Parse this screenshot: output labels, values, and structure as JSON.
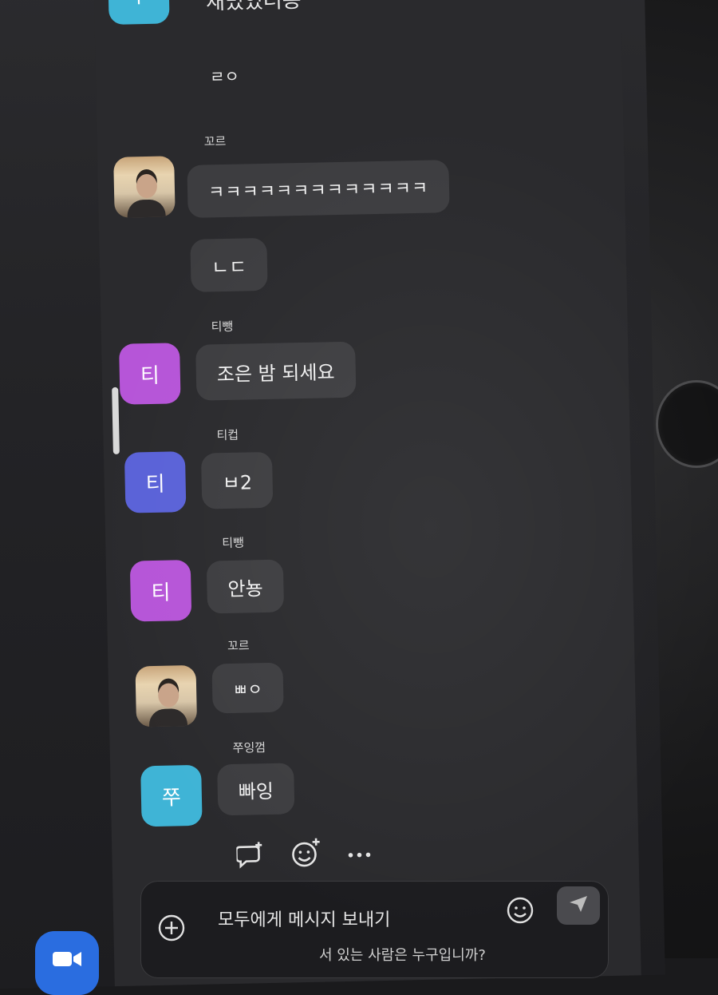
{
  "messages": [
    {
      "kind": "text-only",
      "text": "재밌었더용"
    },
    {
      "kind": "text-only",
      "text": "ㄹㅇ"
    },
    {
      "sender": "꼬르",
      "avatar": "photo",
      "bubbles": [
        "ㅋㅋㅋㅋㅋㅋㅋㅋㅋㅋㅋㅋㅋ",
        "ㄴㄷ"
      ]
    },
    {
      "sender": "티뺑",
      "avatar_initial": "티",
      "bubbles": [
        "조은 밤 되세요"
      ]
    },
    {
      "sender": "티컵",
      "avatar_initial": "티",
      "bubbles": [
        "ㅂ2"
      ]
    },
    {
      "sender": "티뺑",
      "avatar_initial": "티",
      "bubbles": [
        "안뇽"
      ]
    },
    {
      "sender": "꼬르",
      "avatar": "photo",
      "bubbles": [
        "ㅃㅇ"
      ]
    },
    {
      "sender": "쭈잉껌",
      "avatar_initial": "쭈",
      "bubbles": [
        "빠잉"
      ]
    }
  ],
  "top_avatar_initial": "쭈",
  "composer": {
    "placeholder": "모두에게 메시지 보내기",
    "below_text": "서 있는 사람은 누구입니까?"
  },
  "colors": {
    "avatar_teal": "#3fb4d6",
    "avatar_purple": "#b655d8",
    "avatar_indigo": "#5a62d8",
    "bubble": "#3d3d40",
    "panel": "#2a2a2d"
  },
  "icons": [
    "reply-icon",
    "add-reaction-icon",
    "more-icon",
    "plus-icon",
    "emoji-icon",
    "send-icon",
    "video-icon"
  ]
}
